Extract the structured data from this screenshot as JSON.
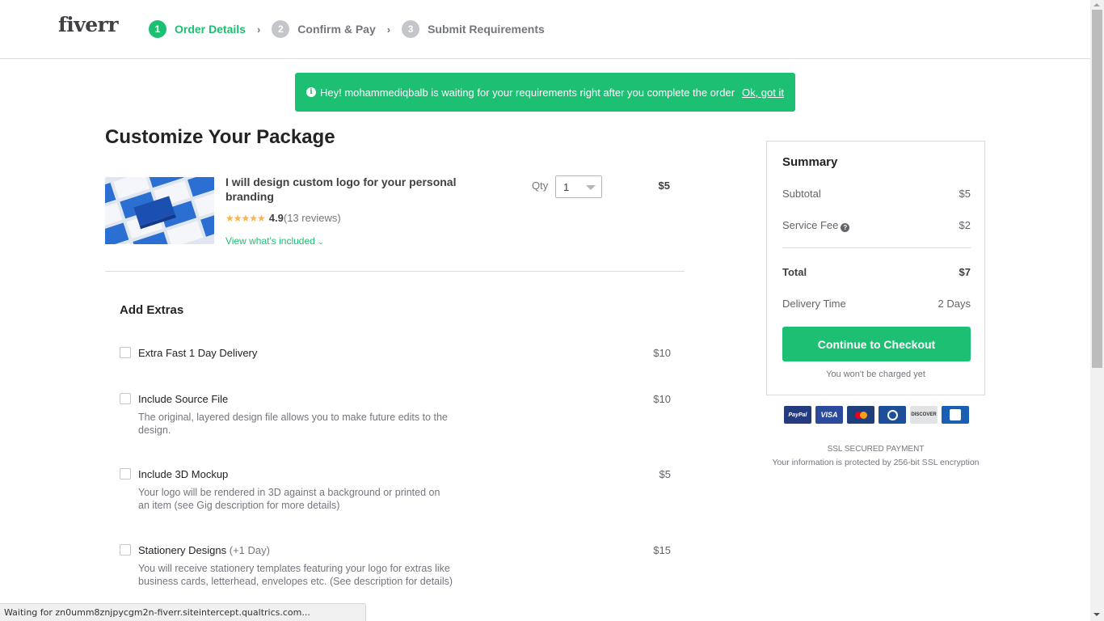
{
  "header": {
    "logo": "fiverr",
    "steps": [
      {
        "num": "1",
        "label": "Order Details",
        "active": true
      },
      {
        "num": "2",
        "label": "Confirm & Pay",
        "active": false
      },
      {
        "num": "3",
        "label": "Submit Requirements",
        "active": false
      }
    ],
    "separator": "›"
  },
  "banner": {
    "icon": "info-icon",
    "message": "Hey! mohammediqbalb is waiting for your requirements right after you complete the order",
    "dismiss_label": "Ok, got it",
    "color": "#1dbf73"
  },
  "main": {
    "title": "Customize Your Package",
    "gig": {
      "title": "I will design custom logo for your personal branding",
      "stars": "★★★★★",
      "rating": "4.9",
      "reviews": "(13 reviews)",
      "view_included": "View what's included",
      "qty_label": "Qty",
      "qty_value": "1",
      "price": "$5"
    },
    "extras_title": "Add Extras",
    "extras": [
      {
        "name": "Extra Fast 1 Day Delivery",
        "note": "",
        "description": "",
        "price": "$10",
        "checked": false
      },
      {
        "name": "Include Source File",
        "note": "",
        "description": "The original, layered design file allows you to make future edits to the design.",
        "price": "$10",
        "checked": false
      },
      {
        "name": "Include 3D Mockup",
        "note": "",
        "description": "Your logo will be rendered in 3D against a background or printed on an item (see Gig description for more details)",
        "price": "$5",
        "checked": false
      },
      {
        "name": "Stationery Designs",
        "note": "(+1 Day)",
        "description": "You will receive stationery templates featuring your logo for extras like business cards, letterhead, envelopes etc. (See description for details)",
        "price": "$15",
        "checked": false
      }
    ]
  },
  "summary": {
    "title": "Summary",
    "subtotal_label": "Subtotal",
    "subtotal": "$5",
    "service_fee_label": "Service Fee",
    "service_fee": "$2",
    "total_label": "Total",
    "total": "$7",
    "delivery_label": "Delivery Time",
    "delivery": "2 Days",
    "checkout_label": "Continue to Checkout",
    "not_charged": "You won't be charged yet"
  },
  "payment": {
    "cards": [
      "PayPal",
      "VISA",
      "MasterCard",
      "Diners Club",
      "DISCOVER",
      "JCB"
    ],
    "ssl_title": "SSL SECURED PAYMENT",
    "ssl_sub": "Your information is protected by 256-bit SSL encryption"
  },
  "statusbar": {
    "text": "Waiting for zn0umm8znjpycgm2n-fiverr.siteintercept.qualtrics.com..."
  }
}
